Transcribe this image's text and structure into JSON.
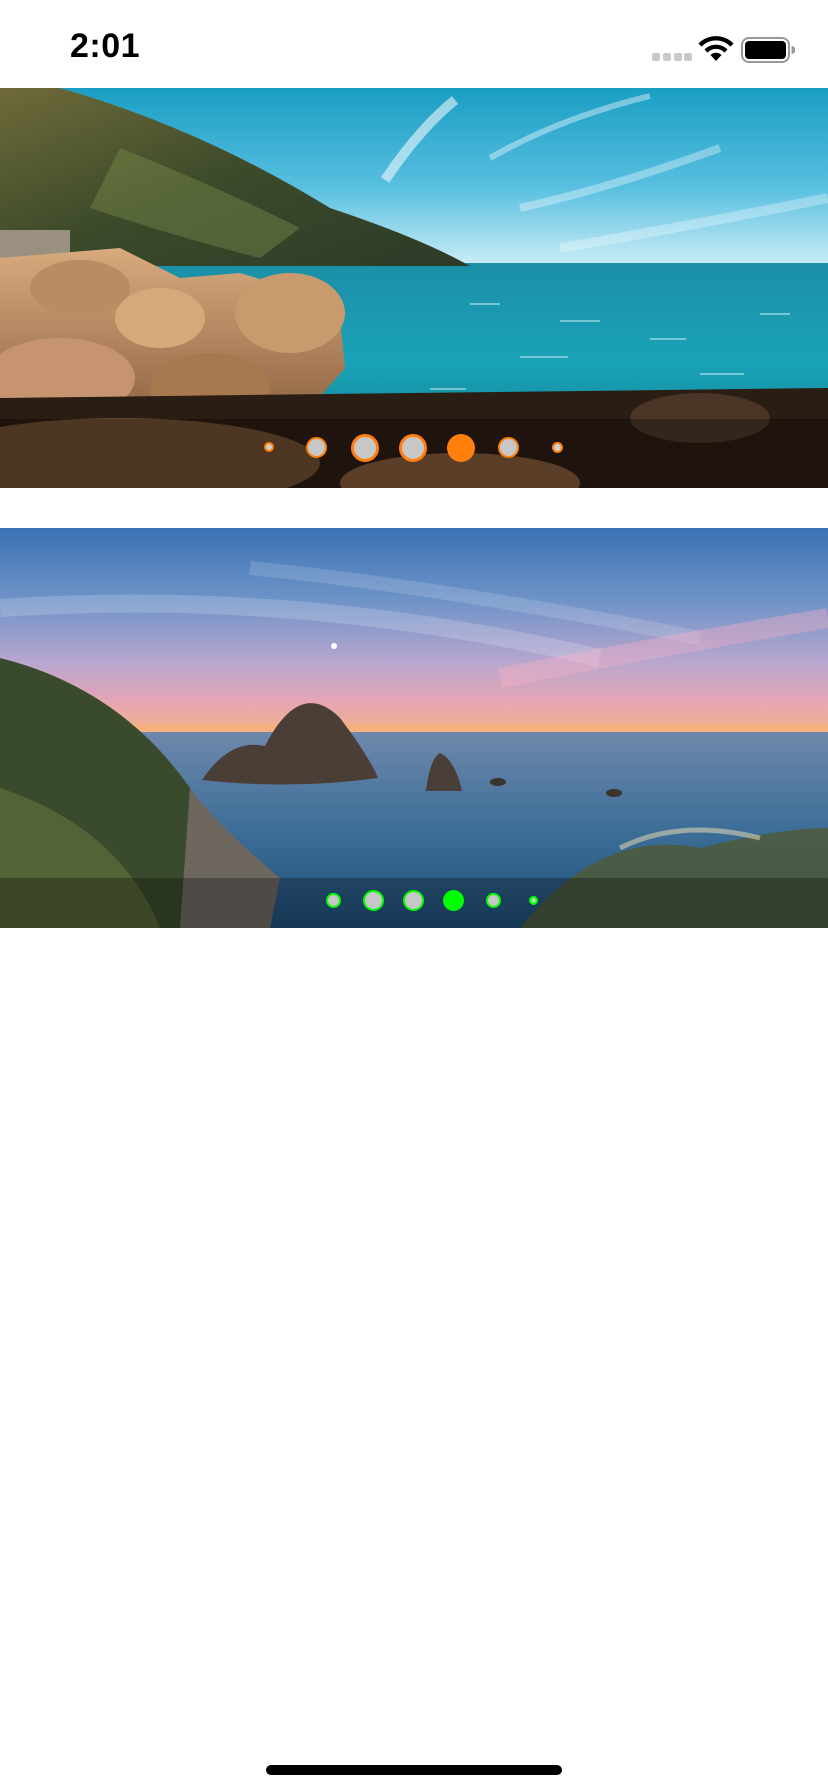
{
  "status_bar": {
    "time": "2:01",
    "icons": [
      "cellular-signal-icon",
      "wifi-icon",
      "battery-icon"
    ]
  },
  "carousels": [
    {
      "image": "rocky-coast-turquoise-sea",
      "page_count": 7,
      "current_page": 5,
      "active_color": "#ff7f0a",
      "inactive_color": "#c7c7c7"
    },
    {
      "image": "sea-stacks-sunset",
      "page_count": 6,
      "current_page": 4,
      "active_color": "#00ff00",
      "inactive_color": "#c7c7c7"
    }
  ],
  "colors": {
    "background": "#ffffff",
    "home_indicator": "#000000"
  }
}
